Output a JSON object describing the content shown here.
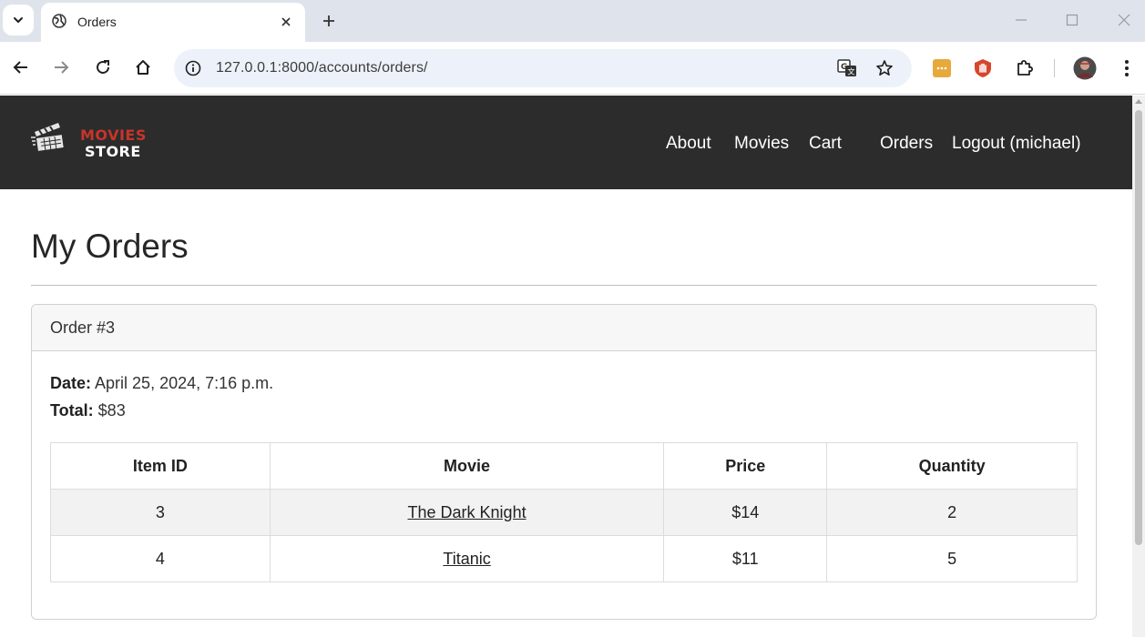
{
  "browser": {
    "tab_title": "Orders",
    "url": "127.0.0.1:8000/accounts/orders/"
  },
  "site": {
    "brand_line1": "MOVIES",
    "brand_line2": "STORE",
    "nav": [
      "About",
      "Movies",
      "Cart",
      "Orders",
      "Logout (michael)"
    ]
  },
  "page": {
    "title": "My Orders",
    "order": {
      "header": "Order #3",
      "date_label": "Date:",
      "date_value": "April 25, 2024, 7:16 p.m.",
      "total_label": "Total:",
      "total_value": "$83",
      "columns": [
        "Item ID",
        "Movie",
        "Price",
        "Quantity"
      ],
      "rows": [
        {
          "id": "3",
          "movie": "The Dark Knight",
          "price": "$14",
          "quantity": "2"
        },
        {
          "id": "4",
          "movie": "Titanic",
          "price": "$11",
          "quantity": "5"
        }
      ]
    }
  },
  "colors": {
    "navbar": "#2c2c2c",
    "brand_accent": "#c7342a",
    "tabstrip": "#dfe3eb",
    "omnibox": "#edf2fa"
  }
}
